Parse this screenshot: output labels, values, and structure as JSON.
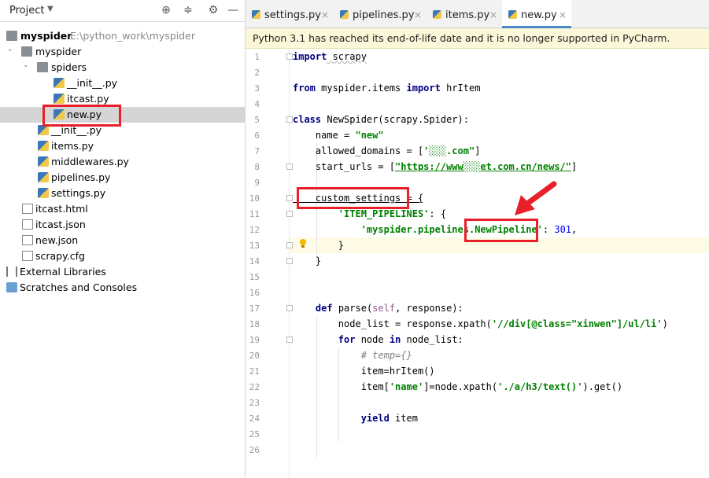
{
  "project_panel": {
    "title": "Project",
    "tree": [
      {
        "label": "myspider",
        "path_hint": "E:\\python_work\\myspider"
      },
      {
        "label": "myspider"
      },
      {
        "label": "spiders"
      },
      {
        "label": "__init__.py"
      },
      {
        "label": "itcast.py"
      },
      {
        "label": "new.py"
      },
      {
        "label": "__init__.py"
      },
      {
        "label": "items.py"
      },
      {
        "label": "middlewares.py"
      },
      {
        "label": "pipelines.py"
      },
      {
        "label": "settings.py"
      },
      {
        "label": "itcast.html"
      },
      {
        "label": "itcast.json"
      },
      {
        "label": "new.json"
      },
      {
        "label": "scrapy.cfg"
      },
      {
        "label": "External Libraries"
      },
      {
        "label": "Scratches and Consoles"
      }
    ]
  },
  "tabs": [
    {
      "label": "settings.py"
    },
    {
      "label": "pipelines.py"
    },
    {
      "label": "items.py"
    },
    {
      "label": "new.py",
      "active": true
    }
  ],
  "banner": "Python 3.1 has reached its end-of-life date and it is no longer supported in PyCharm.",
  "editor": {
    "line_numbers": [
      "1",
      "2",
      "3",
      "4",
      "5",
      "6",
      "7",
      "8",
      "9",
      "10",
      "11",
      "12",
      "13",
      "14",
      "15",
      "16",
      "17",
      "18",
      "19",
      "20",
      "21",
      "22",
      "23",
      "24",
      "25",
      "26"
    ],
    "lines": {
      "l1_kw": "import",
      "l1_rest": " scrapy",
      "l3_kw1": "from",
      "l3_mid": " myspider.items ",
      "l3_kw2": "import",
      "l3_rest": " hrItem",
      "l5_kw": "class",
      "l5_rest": " NewSpider(scrapy.Spider):",
      "l6_a": "    name = ",
      "l6_s": "\"new\"",
      "l7_a": "    allowed_domains = [",
      "l7_s": "'░░░.com\"",
      "l7_b": "]",
      "l8_a": "    start_urls = [",
      "l8_s": "\"https://www░░░et.com.cn/news/\"",
      "l8_b": "]",
      "l10": "    custom_settings = {",
      "l11_s": "        'ITEM_PIPELINES'",
      "l11_b": ": {",
      "l12_s": "            'myspider.pipelines.NewPipeline'",
      "l12_b": ": ",
      "l12_n": "301",
      "l12_c": ",",
      "l13": "        }",
      "l14": "    }",
      "l17_a": "    ",
      "l17_kw": "def",
      "l17_b": " parse(",
      "l17_self": "self",
      "l17_c": ", response):",
      "l18_a": "        node_list = response.xpath(",
      "l18_s": "'//div[@class=\"xinwen\"]/ul/li'",
      "l18_b": ")",
      "l19_a": "        ",
      "l19_kw1": "for",
      "l19_b": " node ",
      "l19_kw2": "in",
      "l19_c": " node_list:",
      "l20": "            # temp={}",
      "l21": "            item=hrItem()",
      "l22_a": "            item[",
      "l22_s": "'name'",
      "l22_b": "]=node.xpath(",
      "l22_s2": "'./a/h3/text()'",
      "l22_c": ").get()",
      "l24_a": "            ",
      "l24_kw": "yield",
      "l24_b": " item"
    }
  },
  "colors": {
    "annotation": "#e8202a",
    "tab_active_underline": "#4a88c7",
    "banner_bg": "#fbf7d8"
  }
}
